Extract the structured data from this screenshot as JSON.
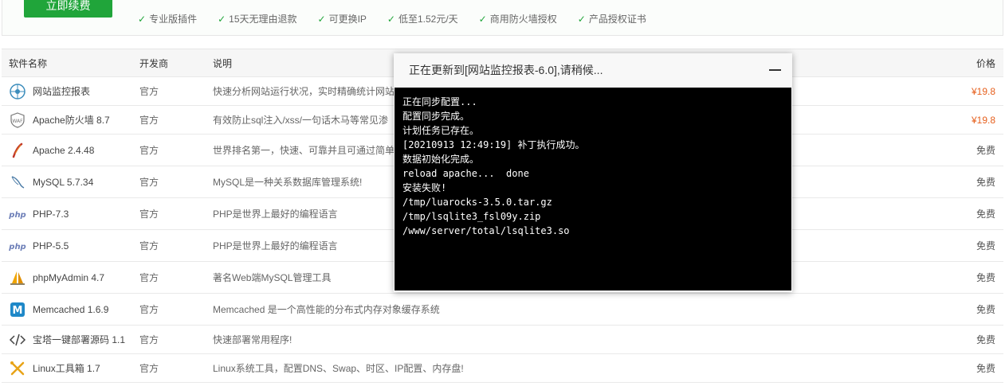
{
  "promo": {
    "renew_button": "立即续费",
    "features": [
      "专业版插件",
      "15天无理由退款",
      "可更换IP",
      "低至1.52元/天",
      "商用防火墙授权",
      "产品授权证书"
    ]
  },
  "table": {
    "headers": {
      "name": "软件名称",
      "developer": "开发商",
      "description": "说明",
      "price": "价格"
    },
    "rows": [
      {
        "icon": "globe-monitor-icon",
        "name": "网站监控报表",
        "developer": "官方",
        "description": "快速分析网站运行状况，实时精确统计网站",
        "price": "¥19.8",
        "paid": true
      },
      {
        "icon": "waf-shield-icon",
        "name": "Apache防火墙 8.7",
        "developer": "官方",
        "description": "有效防止sql注入/xss/一句话木马等常见渗",
        "price": "¥19.8",
        "paid": true
      },
      {
        "icon": "apache-feather-icon",
        "name": "Apache 2.4.48",
        "developer": "官方",
        "description": "世界排名第一，快速、可靠并且可通过简单",
        "price": "免费",
        "paid": false
      },
      {
        "icon": "mysql-dolphin-icon",
        "name": "MySQL 5.7.34",
        "developer": "官方",
        "description": "MySQL是一种关系数据库管理系统!",
        "price": "免费",
        "paid": false
      },
      {
        "icon": "php-icon",
        "name": "PHP-7.3",
        "developer": "官方",
        "description": "PHP是世界上最好的编程语言",
        "price": "免费",
        "paid": false
      },
      {
        "icon": "php-icon",
        "name": "PHP-5.5",
        "developer": "官方",
        "description": "PHP是世界上最好的编程语言",
        "price": "免费",
        "paid": false
      },
      {
        "icon": "phpmyadmin-sail-icon",
        "name": "phpMyAdmin 4.7",
        "developer": "官方",
        "description": "著名Web端MySQL管理工具",
        "price": "免费",
        "paid": false
      },
      {
        "icon": "memcached-m-icon",
        "name": "Memcached 1.6.9",
        "developer": "官方",
        "description": "Memcached 是一个高性能的分布式内存对象缓存系统",
        "price": "免费",
        "paid": false
      },
      {
        "icon": "code-brackets-icon",
        "name": "宝塔一键部署源码 1.1",
        "developer": "官方",
        "description": "快速部署常用程序!",
        "price": "免费",
        "paid": false
      },
      {
        "icon": "tools-icon",
        "name": "Linux工具箱 1.7",
        "developer": "官方",
        "description": "Linux系统工具，配置DNS、Swap、时区、IP配置、内存盘!",
        "price": "免费",
        "paid": false
      }
    ]
  },
  "modal": {
    "title": "正在更新到[网站监控报表-6.0],请稍候...",
    "minimize_icon": "minimize-icon",
    "console_lines": [
      "正在同步配置...",
      "配置同步完成。",
      "计划任务已存在。",
      "[20210913 12:49:19] 补丁执行成功。",
      "数据初始化完成。",
      "reload apache...  done",
      "安装失败!",
      "/tmp/luarocks-3.5.0.tar.gz",
      "/tmp/lsqlite3_fsl09y.zip",
      "/www/server/total/lsqlite3.so"
    ]
  },
  "colors": {
    "accent": "#20a53a",
    "price_paid": "#e6601e",
    "console_bg": "#000000"
  }
}
